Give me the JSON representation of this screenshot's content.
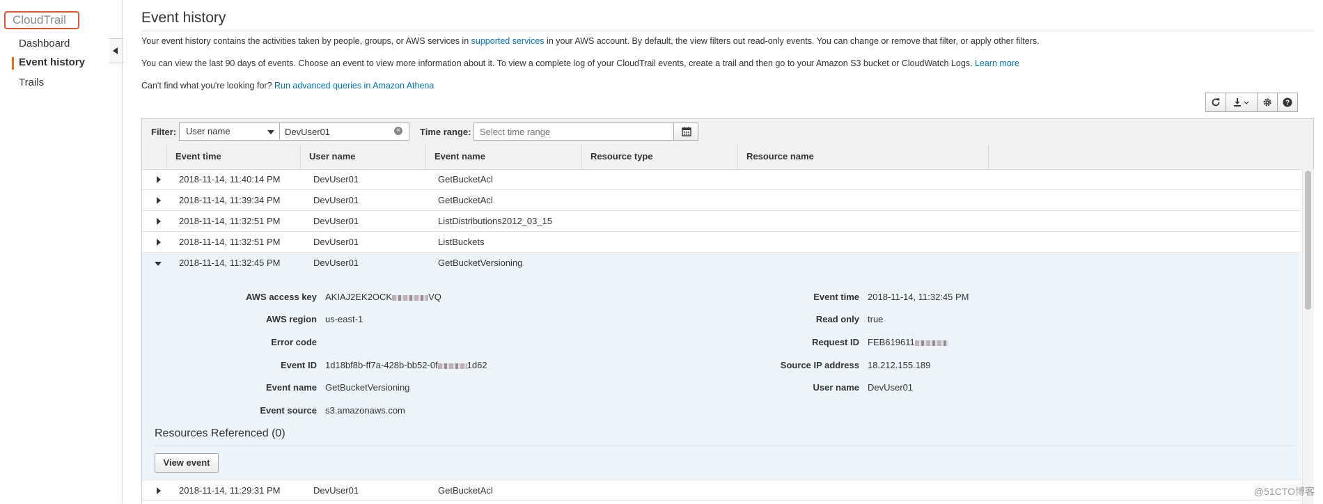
{
  "sidebar": {
    "brand": "CloudTrail",
    "items": [
      {
        "label": "Dashboard",
        "active": false
      },
      {
        "label": "Event history",
        "active": true
      },
      {
        "label": "Trails",
        "active": false
      }
    ]
  },
  "page": {
    "title": "Event history",
    "intro1_before": "Your event history contains the activities taken by people, groups, or AWS services in ",
    "intro1_link": "supported services",
    "intro1_after": " in your AWS account. By default, the view filters out read-only events. You can change or remove that filter, or apply other filters.",
    "intro2_before": "You can view the last 90 days of events. Choose an event to view more information about it. To view a complete log of your CloudTrail events, create a trail and then go to your Amazon S3 bucket or CloudWatch Logs. ",
    "intro2_link": "Learn more",
    "intro3_before": "Can't find what you're looking for? ",
    "intro3_link": "Run advanced queries in Amazon Athena"
  },
  "toolbar": {
    "icons": [
      "refresh-icon",
      "download-icon",
      "settings-icon",
      "help-icon"
    ]
  },
  "filter": {
    "label": "Filter:",
    "attribute": "User name",
    "value": "DevUser01",
    "time_label": "Time range:",
    "time_placeholder": "Select time range"
  },
  "table": {
    "columns": [
      "Event time",
      "User name",
      "Event name",
      "Resource type",
      "Resource name"
    ],
    "rows": [
      {
        "time": "2018-11-14, 11:40:14 PM",
        "user": "DevUser01",
        "event": "GetBucketAcl"
      },
      {
        "time": "2018-11-14, 11:39:34 PM",
        "user": "DevUser01",
        "event": "GetBucketAcl"
      },
      {
        "time": "2018-11-14, 11:32:51 PM",
        "user": "DevUser01",
        "event": "ListDistributions2012_03_15"
      },
      {
        "time": "2018-11-14, 11:32:51 PM",
        "user": "DevUser01",
        "event": "ListBuckets"
      },
      {
        "time": "2018-11-14, 11:32:45 PM",
        "user": "DevUser01",
        "event": "GetBucketVersioning"
      },
      {
        "time": "2018-11-14, 11:29:31 PM",
        "user": "DevUser01",
        "event": "GetBucketAcl"
      }
    ]
  },
  "detail": {
    "left": [
      {
        "label": "AWS access key",
        "value_prefix": "AKIAJ2EK2OCK",
        "value_suffix": "VQ"
      },
      {
        "label": "AWS region",
        "value": "us-east-1"
      },
      {
        "label": "Error code",
        "value": ""
      },
      {
        "label": "Event ID",
        "value_prefix": "1d18bf8b-ff7a-428b-bb52-0f",
        "value_suffix": "1d62"
      },
      {
        "label": "Event name",
        "value": "GetBucketVersioning"
      },
      {
        "label": "Event source",
        "value": "s3.amazonaws.com"
      }
    ],
    "right": [
      {
        "label": "Event time",
        "value": "2018-11-14, 11:32:45 PM"
      },
      {
        "label": "Read only",
        "value": "true"
      },
      {
        "label": "Request ID",
        "value_prefix": "FEB619611"
      },
      {
        "label": "Source IP address",
        "value": "18.212.155.189"
      },
      {
        "label": "User name",
        "value": "DevUser01"
      }
    ],
    "resources_title": "Resources Referenced (0)",
    "view_button": "View event"
  },
  "watermark": "@51CTO博客",
  "colors": {
    "link": "#0073bb",
    "accent": "#ec7211",
    "brand_border": "#e8542e",
    "expanded_bg": "#eef5fa"
  }
}
